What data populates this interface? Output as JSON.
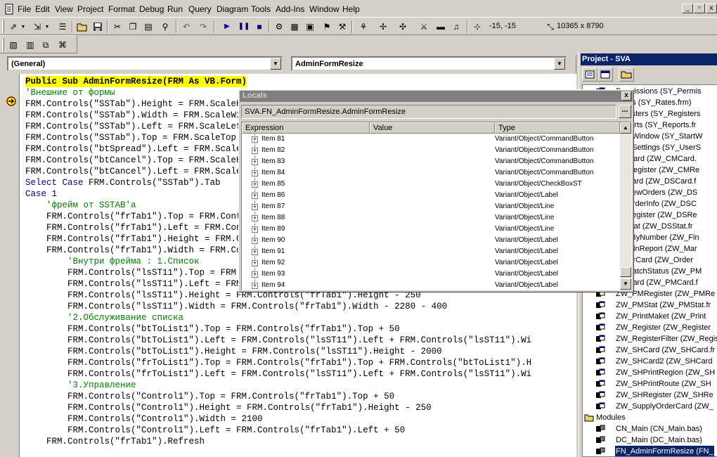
{
  "menubar": {
    "items": [
      "File",
      "Edit",
      "View",
      "Project",
      "Format",
      "Debug",
      "Run",
      "Query",
      "Diagram",
      "Tools",
      "Add-Ins",
      "Window",
      "Help"
    ],
    "window_buttons": [
      "_",
      "▫",
      "x"
    ]
  },
  "toolbar": {
    "position_readout": "-15, -15",
    "size_readout": "10365 x 8790"
  },
  "code_window": {
    "object_combo": "(General)",
    "procedure_combo": "AdminFormResize",
    "lines": [
      {
        "text": "Public Sub AdminFormResize(FRM As VB.Form)",
        "style": "hl"
      },
      {
        "text": "'Внешние от формы",
        "style": "cm"
      },
      {
        "text": "FRM.Controls(\"SSTab\").Height = FRM.ScaleHeight - 350",
        "style": ""
      },
      {
        "text": "FRM.Controls(\"SSTab\").Width = FRM.ScaleWidth - 200",
        "style": ""
      },
      {
        "text": "FRM.Controls(\"SSTab\").Left = FRM.ScaleLeft + 100",
        "style": ""
      },
      {
        "text": "FRM.Controls(\"SSTab\").Top = FRM.ScaleTop + 100",
        "style": ""
      },
      {
        "text": "FRM.Controls(\"btSpread\").Left = FRM.ScaleWidth - 1250",
        "style": ""
      },
      {
        "text": "FRM.Controls(\"btCancel\").Top = FRM.ScaleHeight - 400",
        "style": ""
      },
      {
        "text": "FRM.Controls(\"btCancel\").Left = FRM.ScaleWidth - 1250",
        "style": ""
      },
      {
        "text": "Select Case FRM.Controls(\"SSTab\").Tab",
        "style": "kwline"
      },
      {
        "text": "Case 1",
        "style": "kwline"
      },
      {
        "text": "    'фрейм от SSTAB'а",
        "style": "cm"
      },
      {
        "text": "    FRM.Controls(\"frTab1\").Top = FRM.Controls(\"SSTab\").Top + 400",
        "style": ""
      },
      {
        "text": "    FRM.Controls(\"frTab1\").Left = FRM.Controls(\"SSTab\").Left + 100",
        "style": ""
      },
      {
        "text": "    FRM.Controls(\"frTab1\").Height = FRM.Controls(\"SSTab\").Height - 500",
        "style": ""
      },
      {
        "text": "    FRM.Controls(\"frTab1\").Width = FRM.Controls(\"SSTab\").Width - 200",
        "style": ""
      },
      {
        "text": "        'Внутри фрейма : 1.Список",
        "style": "cm"
      },
      {
        "text": "        FRM.Controls(\"lsST11\").Top = FRM.Controls(\"frTab1\").Top + 50",
        "style": ""
      },
      {
        "text": "        FRM.Controls(\"lsST11\").Left = FRM.Controls(\"frTab1\").Left + 50",
        "style": ""
      },
      {
        "text": "        FRM.Controls(\"lsST11\").Height = FRM.Controls(\"frTab1\").Height - 250",
        "style": ""
      },
      {
        "text": "        FRM.Controls(\"lsST11\").Width = FRM.Controls(\"frTab1\").Width - 2280 - 400",
        "style": ""
      },
      {
        "text": "        '2.Обслуживание списка",
        "style": "cm"
      },
      {
        "text": "        FRM.Controls(\"btToList1\").Top = FRM.Controls(\"frTab1\").Top + 50",
        "style": ""
      },
      {
        "text": "        FRM.Controls(\"btToList1\").Left = FRM.Controls(\"lsST11\").Left + FRM.Controls(\"lsST11\").Wi",
        "style": ""
      },
      {
        "text": "        FRM.Controls(\"btToList1\").Height = FRM.Controls(\"lsST11\").Height - 2000",
        "style": ""
      },
      {
        "text": "        FRM.Controls(\"frToList1\").Top = FRM.Controls(\"frTab1\").Top + FRM.Controls(\"btToList1\").H",
        "style": ""
      },
      {
        "text": "        FRM.Controls(\"frToList1\").Left = FRM.Controls(\"lsST11\").Left + FRM.Controls(\"lsST11\").Wi",
        "style": ""
      },
      {
        "text": "        '3.Управление",
        "style": "cm"
      },
      {
        "text": "        FRM.Controls(\"Control1\").Top = FRM.Controls(\"frTab1\").Top + 50",
        "style": ""
      },
      {
        "text": "        FRM.Controls(\"Control1\").Height = FRM.Controls(\"frTab1\").Height - 250",
        "style": ""
      },
      {
        "text": "        FRM.Controls(\"Control1\").Width = 2100",
        "style": ""
      },
      {
        "text": "        FRM.Controls(\"Control1\").Left = FRM.Controls(\"frTab1\").Left + 50",
        "style": ""
      },
      {
        "text": "    FRM.Controls(\"frTab1\").Refresh",
        "style": ""
      }
    ]
  },
  "project": {
    "title": "Project - SVA",
    "tree": [
      {
        "label": "Permissions (SY_Permis",
        "kind": "form"
      },
      {
        "label": "Rates (SY_Rates.frm)",
        "kind": "form"
      },
      {
        "label": "Registers (SY_Registers",
        "kind": "form"
      },
      {
        "label": "Reports (SY_Reports.fr",
        "kind": "form"
      },
      {
        "label": "StartWindow (SY_StartW",
        "kind": "form"
      },
      {
        "label": "UserSettings (SY_UserS",
        "kind": "form"
      },
      {
        "label": "CMCard (ZW_CMCard.",
        "kind": "form"
      },
      {
        "label": "CMRegister (ZW_CMRe",
        "kind": "form"
      },
      {
        "label": "DSCard (ZW_DSCard.f",
        "kind": "form"
      },
      {
        "label": "DSNewOrders (ZW_DS",
        "kind": "form"
      },
      {
        "label": "DSOrderInfo (ZW_DSC",
        "kind": "form"
      },
      {
        "label": "DSRegister (ZW_DSRe",
        "kind": "form"
      },
      {
        "label": "DSStat (ZW_DSStat.fr",
        "kind": "form"
      },
      {
        "label": "FindByNumber (ZW_Fin",
        "kind": "form"
      },
      {
        "label": "MarginReport (ZW_Mar",
        "kind": "form"
      },
      {
        "label": "OrderCard (ZW_Order",
        "kind": "form"
      },
      {
        "label": "PMBatchStatus (ZW_PM",
        "kind": "form"
      },
      {
        "label": "PMCard (ZW_PMCard.f",
        "kind": "form"
      },
      {
        "label": "ZW_PMRegister (ZW_PMRe",
        "kind": "form"
      },
      {
        "label": "ZW_PMStat (ZW_PMStat.fr",
        "kind": "form"
      },
      {
        "label": "ZW_PrintMaket (ZW_Print",
        "kind": "form"
      },
      {
        "label": "ZW_Register (ZW_Register",
        "kind": "form"
      },
      {
        "label": "ZW_RegisterFilter (ZW_Register",
        "kind": "form"
      },
      {
        "label": "ZW_SHCard (ZW_SHCard.fr",
        "kind": "form"
      },
      {
        "label": "ZW_SHCard2 (ZW_SHCard",
        "kind": "form"
      },
      {
        "label": "ZW_SHPrintRegion (ZW_SH",
        "kind": "form"
      },
      {
        "label": "ZW_SHPrintRoute (ZW_SH",
        "kind": "form"
      },
      {
        "label": "ZW_SHRegister (ZW_SHRe",
        "kind": "form"
      },
      {
        "label": "ZW_SupplyOrderCard (ZW_",
        "kind": "form"
      },
      {
        "label": "Modules",
        "kind": "folder"
      },
      {
        "label": "CN_Main (CN_Main.bas)",
        "kind": "module"
      },
      {
        "label": "DC_Main (DC_Main.bas)",
        "kind": "module"
      },
      {
        "label": "FN_AdminFormResize (FN_",
        "kind": "module",
        "selected": true
      }
    ]
  },
  "locals": {
    "title": "Locals",
    "close": "x",
    "context": "SVA.FN_AdminFormResize.AdminFormResize",
    "dots": "...",
    "columns": [
      "Expression",
      "Value",
      "Type"
    ],
    "rows": [
      {
        "name": "Item 81",
        "value": "",
        "type": "Variant/Object/CommandButton"
      },
      {
        "name": "Item 82",
        "value": "",
        "type": "Variant/Object/CommandButton"
      },
      {
        "name": "Item 83",
        "value": "",
        "type": "Variant/Object/CommandButton"
      },
      {
        "name": "Item 84",
        "value": "",
        "type": "Variant/Object/CommandButton"
      },
      {
        "name": "Item 85",
        "value": "",
        "type": "Variant/Object/CheckBoxST"
      },
      {
        "name": "Item 86",
        "value": "",
        "type": "Variant/Object/Label"
      },
      {
        "name": "Item 87",
        "value": "",
        "type": "Variant/Object/Line"
      },
      {
        "name": "Item 88",
        "value": "",
        "type": "Variant/Object/Line"
      },
      {
        "name": "Item 89",
        "value": "",
        "type": "Variant/Object/Line"
      },
      {
        "name": "Item 90",
        "value": "",
        "type": "Variant/Object/Label"
      },
      {
        "name": "Item 91",
        "value": "",
        "type": "Variant/Object/Label"
      },
      {
        "name": "Item 92",
        "value": "",
        "type": "Variant/Object/Label"
      },
      {
        "name": "Item 93",
        "value": "",
        "type": "Variant/Object/Label"
      },
      {
        "name": "Item 94",
        "value": "",
        "type": "Variant/Object/Label"
      }
    ]
  }
}
